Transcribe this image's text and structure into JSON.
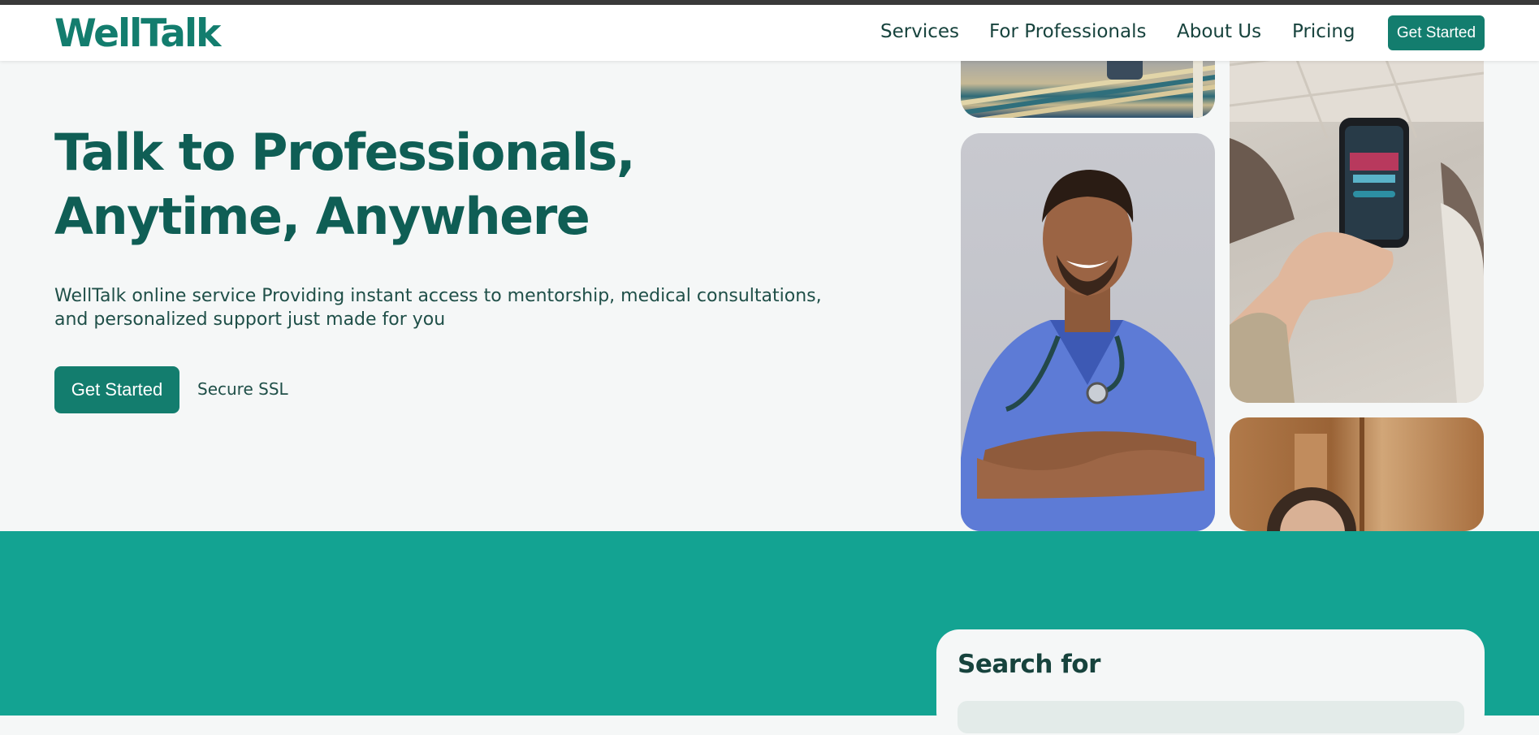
{
  "brand": {
    "logo": "WellTalk",
    "accent": "#137d6e",
    "section_bg": "#13a392"
  },
  "nav": {
    "items": [
      "Services",
      "For Professionals",
      "About Us",
      "Pricing"
    ],
    "cta": "Get Started"
  },
  "hero": {
    "title": "Talk to Professionals, Anytime, Anywhere",
    "subtitle": "WellTalk online service Providing instant access to mentorship, medical consultations, and personalized support just made for you",
    "cta": "Get Started",
    "secure": "Secure SSL"
  },
  "gallery": {
    "images": [
      "sofa-rug-photo",
      "smiling-doctor-photo",
      "phone-in-hand-photo",
      "woman-wood-interior-photo"
    ]
  },
  "search": {
    "title": "Search for",
    "placeholder": ""
  }
}
